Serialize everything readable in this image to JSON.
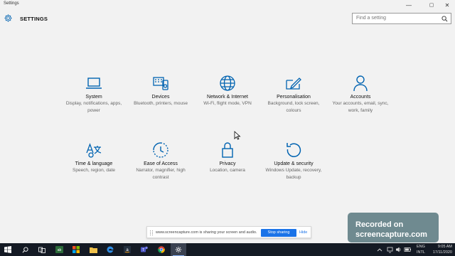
{
  "window": {
    "title": "Settings",
    "controls": {
      "minimize": "—",
      "maximize": "▢",
      "close": "✕"
    }
  },
  "header": {
    "title": "SETTINGS",
    "icon": "gear-icon"
  },
  "search": {
    "placeholder": "Find a setting",
    "icon": "search-icon"
  },
  "tiles": [
    {
      "name": "System",
      "desc": "Display, notifications, apps, power",
      "icon": "laptop-icon"
    },
    {
      "name": "Devices",
      "desc": "Bluetooth, printers, mouse",
      "icon": "devices-icon"
    },
    {
      "name": "Network & Internet",
      "desc": "Wi-Fi, flight mode, VPN",
      "icon": "globe-icon"
    },
    {
      "name": "Personalisation",
      "desc": "Background, lock screen, colours",
      "icon": "paint-icon"
    },
    {
      "name": "Accounts",
      "desc": "Your accounts, email, sync, work, family",
      "icon": "person-icon"
    },
    {
      "name": "Time & language",
      "desc": "Speech, region, date",
      "icon": "time-language-icon"
    },
    {
      "name": "Ease of Access",
      "desc": "Narrator, magnifier, high contrast",
      "icon": "ease-of-access-icon"
    },
    {
      "name": "Privacy",
      "desc": "Location, camera",
      "icon": "lock-icon"
    },
    {
      "name": "Update & security",
      "desc": "Windows Update, recovery, backup",
      "icon": "update-icon"
    }
  ],
  "share_bar": {
    "message": "www.screencapture.com is sharing your screen and audio.",
    "stop_label": "Stop sharing",
    "hide_label": "Hide"
  },
  "watermark": {
    "line1": "Recorded on",
    "line2": "screencapture.com"
  },
  "taskbar": {
    "items": [
      "start-icon",
      "search-icon",
      "task-view-icon",
      "app-icon",
      "store-icon",
      "file-explorer-icon",
      "edge-icon",
      "amazon-icon",
      "teams-icon",
      "chrome-icon",
      "settings-icon"
    ],
    "tray": {
      "lang_top": "ENG",
      "lang_bottom": "INTL",
      "time": "9:05 AM",
      "date": "17/11/2020"
    }
  },
  "colors": {
    "accent": "#0063b1",
    "taskbar": "#141a24",
    "watermark": "#6f8a90",
    "stop_button": "#1a73e8"
  }
}
